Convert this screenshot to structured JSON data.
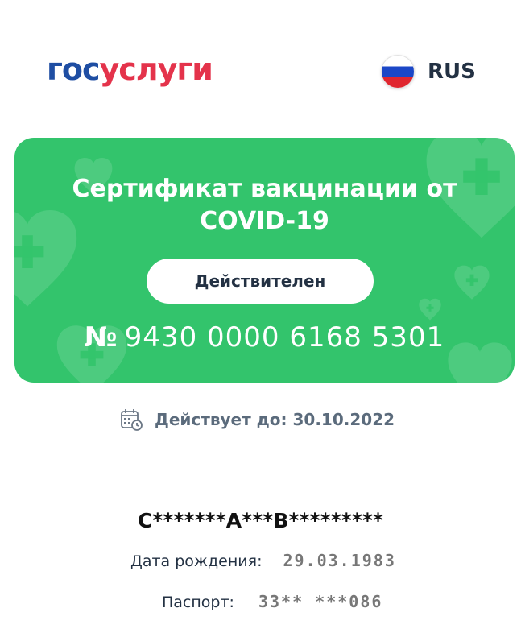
{
  "header": {
    "logo_part1": "гос",
    "logo_part2": "услуги",
    "language": "RUS",
    "flag_icon": "russia-flag-icon"
  },
  "certificate": {
    "title_line1": "Сертификат вакцинации от",
    "title_line2": "COVID-19",
    "status": "Действителен",
    "number_sign": "№",
    "number": "9430 0000 6168 5301",
    "card_color": "#33c46c"
  },
  "validity": {
    "icon": "calendar-clock-icon",
    "text": "Действует до: 30.10.2022"
  },
  "holder": {
    "name": "С*******А***В*********",
    "birth_label": "Дата рождения:",
    "birth_value": "29.03.1983",
    "passport_label": "Паспорт:",
    "passport_value": "33** ***086"
  },
  "colors": {
    "brand_blue": "#1f4ea3",
    "brand_red": "#e4334b",
    "valid_green": "#33c46c"
  }
}
